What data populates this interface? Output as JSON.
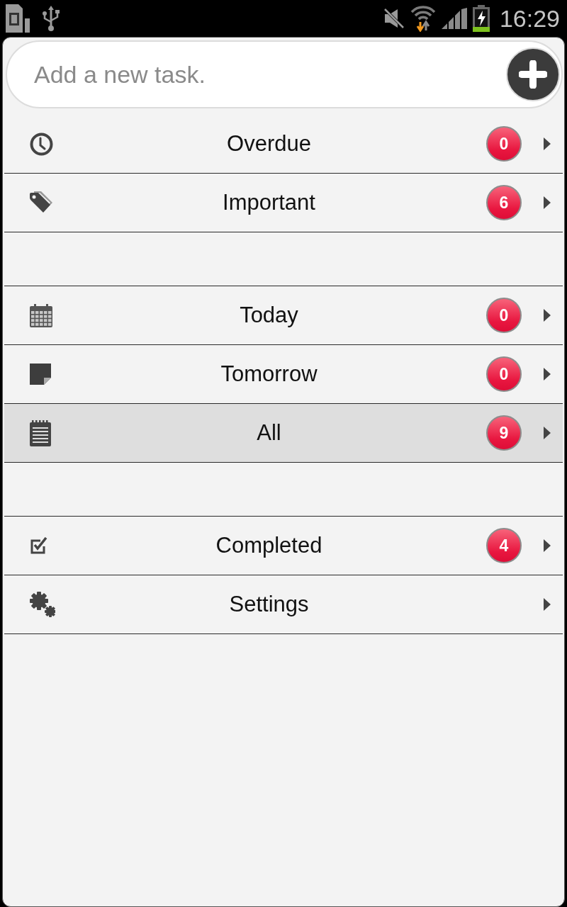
{
  "status_bar": {
    "time": "16:29"
  },
  "new_task": {
    "placeholder": "Add a new task."
  },
  "groups": [
    {
      "items": [
        {
          "kind": "clock",
          "label": "Overdue",
          "count": "0",
          "selected": false
        },
        {
          "kind": "tag",
          "label": "Important",
          "count": "6",
          "selected": false
        }
      ]
    },
    {
      "items": [
        {
          "kind": "calendar",
          "label": "Today",
          "count": "0",
          "selected": false
        },
        {
          "kind": "note",
          "label": "Tomorrow",
          "count": "0",
          "selected": false
        },
        {
          "kind": "notepad",
          "label": "All",
          "count": "9",
          "selected": true
        }
      ]
    },
    {
      "items": [
        {
          "kind": "checkbox",
          "label": "Completed",
          "count": "4",
          "selected": false
        },
        {
          "kind": "gears",
          "label": "Settings",
          "selected": false
        }
      ]
    }
  ]
}
